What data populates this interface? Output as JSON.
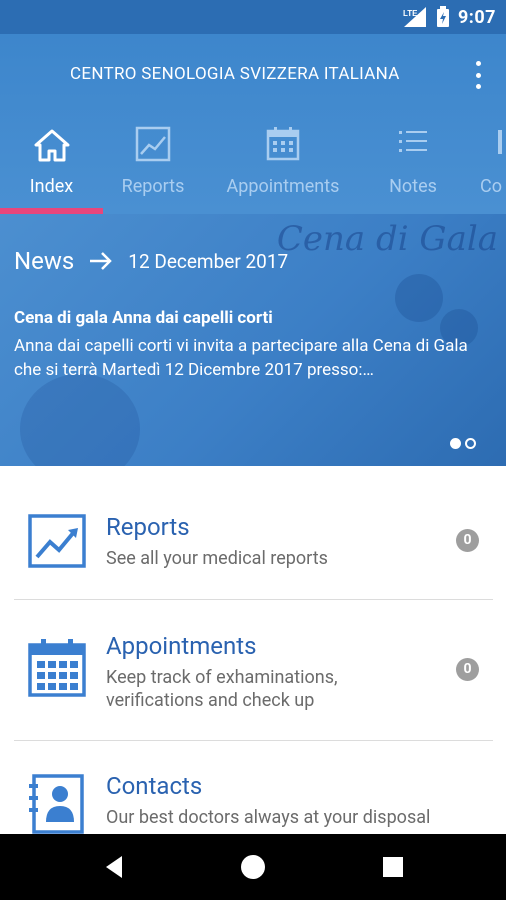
{
  "status_bar": {
    "network": "LTE",
    "time": "9:07",
    "icons": [
      "signal-icon",
      "battery-charging-icon"
    ]
  },
  "app": {
    "title": "CENTRO SENOLOGIA SVIZZERA ITALIANA",
    "menu_icon": "overflow-menu-icon"
  },
  "tabs": [
    {
      "label": "Index",
      "icon": "home-icon",
      "active": true
    },
    {
      "label": "Reports",
      "icon": "chart-icon",
      "active": false
    },
    {
      "label": "Appointments",
      "icon": "calendar-icon",
      "active": false
    },
    {
      "label": "Notes",
      "icon": "list-icon",
      "active": false
    },
    {
      "label": "Co",
      "icon": "contacts-icon",
      "active": false
    }
  ],
  "news": {
    "label": "News",
    "arrow_icon": "arrow-right-icon",
    "date": "12 December 2017",
    "background_text": "Cena di Gala",
    "title": "Cena di gala Anna dai capelli corti",
    "body": "Anna dai capelli corti vi invita a partecipare alla Cena di Gala che si terrà Martedì 12 Dicembre 2017 presso:…",
    "carousel_total": 2,
    "carousel_index": 1
  },
  "sections": [
    {
      "title": "Reports",
      "description": "See all your medical reports",
      "count": "0",
      "icon": "chart-icon"
    },
    {
      "title": "Appointments",
      "description": "Keep track of exhaminations, verifications and check up",
      "count": "0",
      "icon": "calendar-icon"
    },
    {
      "title": "Contacts",
      "description": "Our best doctors always at your disposal",
      "icon": "contacts-book-icon"
    }
  ],
  "colors": {
    "primary": "#3d86cc",
    "status_bar": "#2c6db3",
    "accent": "#e8467c",
    "title_blue": "#2a62b0",
    "badge": "#9e9e9e"
  },
  "nav_bar": {
    "buttons": [
      "back-icon",
      "home-circle-icon",
      "recents-icon"
    ]
  }
}
